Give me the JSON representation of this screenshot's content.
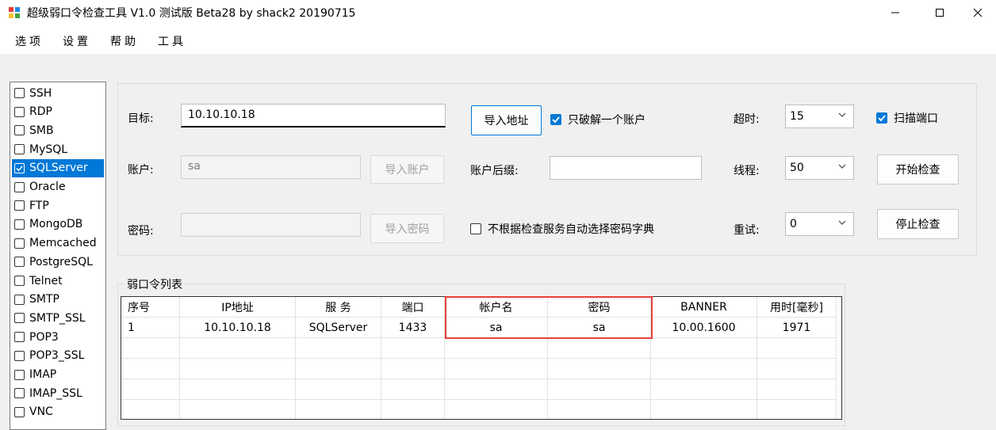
{
  "window": {
    "title": "超级弱口令检查工具 V1.0 测试版 Beta28 by shack2 20190715",
    "app_icon": "app-icon",
    "controls": {
      "minimize": "—",
      "maximize": "☐",
      "close": "✕"
    }
  },
  "menu": [
    "选项",
    "设置",
    "帮助",
    "工具"
  ],
  "services": [
    {
      "label": "SSH",
      "checked": false
    },
    {
      "label": "RDP",
      "checked": false
    },
    {
      "label": "SMB",
      "checked": false
    },
    {
      "label": "MySQL",
      "checked": false
    },
    {
      "label": "SQLServer",
      "checked": true
    },
    {
      "label": "Oracle",
      "checked": false
    },
    {
      "label": "FTP",
      "checked": false
    },
    {
      "label": "MongoDB",
      "checked": false
    },
    {
      "label": "Memcached",
      "checked": false
    },
    {
      "label": "PostgreSQL",
      "checked": false
    },
    {
      "label": "Telnet",
      "checked": false
    },
    {
      "label": "SMTP",
      "checked": false
    },
    {
      "label": "SMTP_SSL",
      "checked": false
    },
    {
      "label": "POP3",
      "checked": false
    },
    {
      "label": "POP3_SSL",
      "checked": false
    },
    {
      "label": "IMAP",
      "checked": false
    },
    {
      "label": "IMAP_SSL",
      "checked": false
    },
    {
      "label": "VNC",
      "checked": false
    }
  ],
  "config": {
    "target_label": "目标:",
    "target_value": "10.10.10.18",
    "import_address": "导入地址",
    "crack_one_account": {
      "label": "只破解一个账户",
      "checked": true
    },
    "timeout_label": "超时:",
    "timeout_value": "15",
    "scan_port": {
      "label": "扫描端口",
      "checked": true
    },
    "account_label": "账户:",
    "account_value": "sa",
    "import_account": "导入账户",
    "account_suffix_label": "账户后缀:",
    "account_suffix_value": "",
    "threads_label": "线程:",
    "threads_value": "50",
    "start_check": "开始检查",
    "password_label": "密码:",
    "password_value": "",
    "import_password": "导入密码",
    "no_auto_dict": {
      "label": "不根据检查服务自动选择密码字典",
      "checked": false
    },
    "retry_label": "重试:",
    "retry_value": "0",
    "stop_check": "停止检查",
    "dropdown_arrow": "chevron-down-icon"
  },
  "results": {
    "legend": "弱口令列表",
    "columns": [
      "序号",
      "IP地址",
      "服 务",
      "端口",
      "帐户名",
      "密码",
      "BANNER",
      "用时[毫秒]"
    ],
    "rows": [
      [
        "1",
        "10.10.10.18",
        "SQLServer",
        "1433",
        "sa",
        "sa",
        "10.00.1600",
        "1971"
      ]
    ],
    "highlight_color": "#e8403a"
  },
  "colors": {
    "selection": "#0078d7",
    "window_bg": "#f0f0f0"
  }
}
